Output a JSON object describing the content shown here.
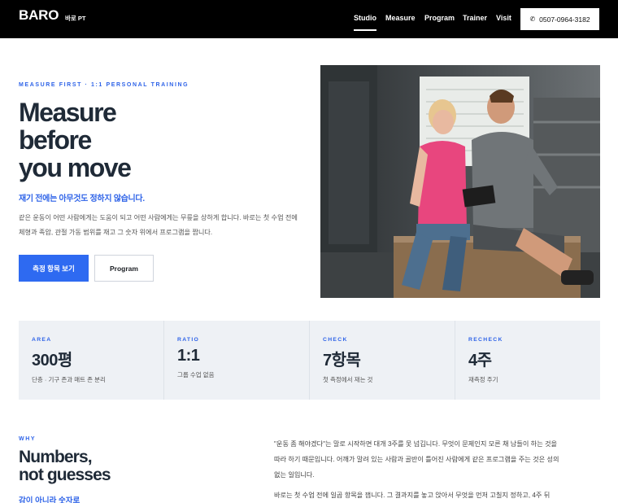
{
  "nav": {
    "logo": "BARO",
    "logo_sub": "바로 PT",
    "links": [
      "Studio",
      "Measure",
      "Program",
      "Trainer",
      "Visit"
    ],
    "phone": "0507-0964-3182",
    "phone_icon": "phone-icon"
  },
  "hero": {
    "eyebrow": "MEASURE FIRST · 1:1 PERSONAL TRAINING",
    "title_lines": [
      "Measure",
      "before",
      "you move"
    ],
    "subtitle": "재기 전에는 아무것도 정하지 않습니다.",
    "body": "같은 운동이 어떤 사람에게는 도움이 되고 어떤 사람에게는 무릎을 상하게 합니다. 바로는 첫 수업 전에 체형과 족압, 관절 가동 범위를 재고 그 숫자 위에서 프로그램을 짭니다.",
    "primary_button": "측정 항목 보기",
    "secondary_button": "Program"
  },
  "stats": [
    {
      "label": "AREA",
      "value": "300평",
      "desc": "단층 · 기구 존과 매트 존 분리"
    },
    {
      "label": "RATIO",
      "value": "1:1",
      "desc": "그룹 수업 없음"
    },
    {
      "label": "CHECK",
      "value": "7항목",
      "desc": "첫 측정에서 재는 것"
    },
    {
      "label": "RECHECK",
      "value": "4주",
      "desc": "재측정 주기"
    }
  ],
  "why": {
    "eyebrow": "WHY",
    "title_lines": [
      "Numbers,",
      "not guesses"
    ],
    "subtitle": "감이 아니라 숫자로",
    "paragraphs": [
      "\"운동 좀 해야겠다\"는 말로 시작하면 대개 3주를 못 넘깁니다. 무엇이 문제인지 모른 채 남들이 하는 것을 따라 하기 때문입니다. 어깨가 말려 있는 사람과 골반이 틀어진 사람에게 같은 프로그램을 주는 것은 성의 없는 일입니다.",
      "바로는 첫 수업 전에 일곱 항목을 잽니다. 그 결과지를 놓고 앉아서 무엇을 먼저 고칠지 정하고, 4주 뒤"
    ]
  }
}
